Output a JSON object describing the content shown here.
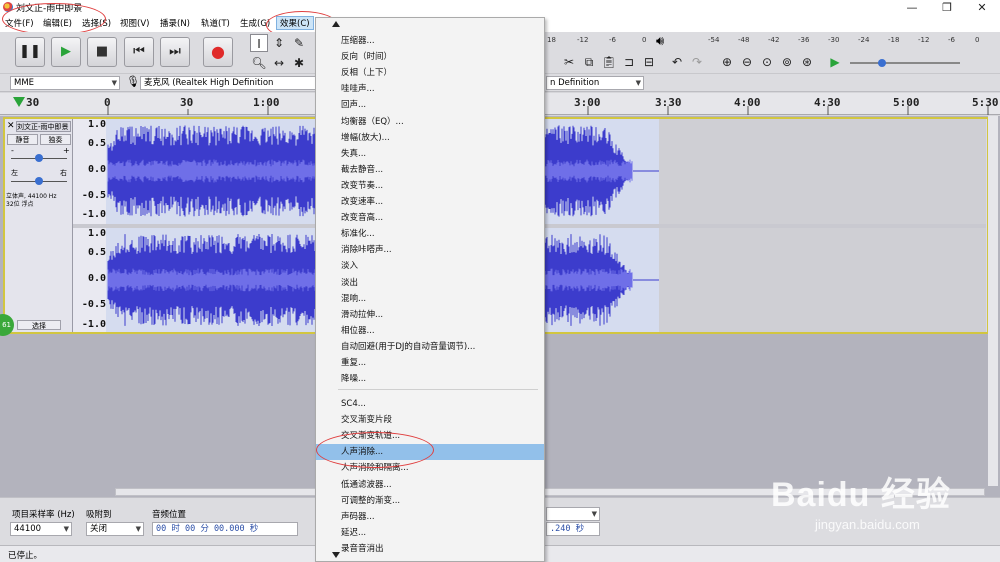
{
  "window": {
    "title": "刘文正-雨中即景",
    "controls": {
      "minimize": "—",
      "maximize": "❐",
      "close": "✕"
    }
  },
  "menubar": [
    "文件(F)",
    "编辑(E)",
    "选择(S)",
    "视图(V)",
    "播录(N)",
    "轨道(T)",
    "生成(G)",
    "效果(C)"
  ],
  "transport": {
    "buttons": [
      "pause-icon",
      "play-icon",
      "stop-icon",
      "skip-start-icon",
      "skip-end-icon",
      "record-icon"
    ]
  },
  "meter": {
    "ticks_left": [
      "18",
      "-12",
      "-6",
      "0"
    ],
    "ticks_right": [
      "-54",
      "-48",
      "-42",
      "-36",
      "-30",
      "-24",
      "-18",
      "-12",
      "-6",
      "0"
    ]
  },
  "devices": {
    "host": "MME",
    "mic": "麦克风 (Realtek High Definition",
    "playback": "n Definition"
  },
  "timeline": {
    "labels": [
      "30",
      "0",
      "30",
      "1:00",
      "3:00",
      "3:30",
      "4:00",
      "4:30",
      "5:00",
      "5:30"
    ]
  },
  "track": {
    "name": "刘文正-雨中即景",
    "mute": "静音",
    "solo": "独奏",
    "gain_minus": "-",
    "gain_plus": "+",
    "pan_left": "左",
    "pan_right": "右",
    "info_line1": "立体声, 44100 Hz",
    "info_line2": "32位 浮点",
    "select": "选择",
    "badge": "61",
    "y_labels_top": [
      "1.0",
      "0.5",
      "0.0",
      "-0.5",
      "-1.0"
    ],
    "y_labels_bottom": [
      "1.0",
      "0.5",
      "0.0",
      "-0.5",
      "-1.0"
    ]
  },
  "effect_menu": {
    "items": [
      "压缩器...",
      "反向（时间）",
      "反相（上下）",
      "哇哇声...",
      "回声...",
      "均衡器（EQ）...",
      "增幅(放大)...",
      "失真...",
      "截去静音...",
      "改变节奏...",
      "改变速率...",
      "改变音高...",
      "标准化...",
      "消除咔嗒声...",
      "淡入",
      "淡出",
      "混响...",
      "滑动拉伸...",
      "相位器...",
      "自动回避(用于DJ的自动音量调节)...",
      "重复...",
      "降噪..."
    ],
    "items2": [
      "SC4...",
      "交叉渐变片段",
      "交叉渐变轨道...",
      "人声消除...",
      "人声消除和隔离...",
      "低通滤波器...",
      "可调整的渐变...",
      "声码器...",
      "延迟...",
      "录音音消出"
    ],
    "highlighted": "人声消除..."
  },
  "bottombar": {
    "rate_label": "项目采样率 (Hz)",
    "rate_value": "44100",
    "snap_label": "吸附到",
    "snap_value": "关闭",
    "position_label": "音频位置",
    "position_value": "00 时 00 分 00.000 秒",
    "selection_end": ".240 秒"
  },
  "status": {
    "text": "已停止。"
  },
  "watermark": {
    "brand": "Baidu 经验",
    "url": "jingyan.baidu.com"
  }
}
